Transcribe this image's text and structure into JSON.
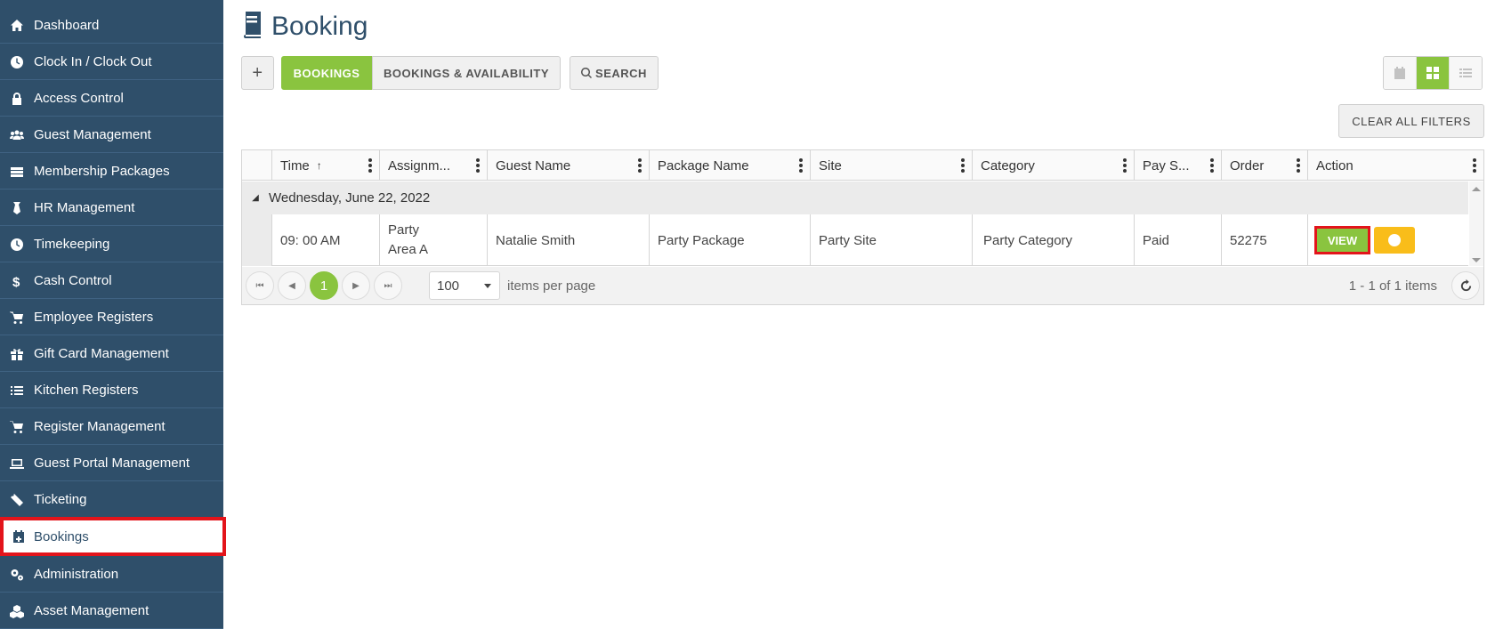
{
  "sidebar": {
    "items": [
      {
        "label": "Dashboard",
        "icon": "home-icon"
      },
      {
        "label": "Clock In / Clock Out",
        "icon": "clock-icon"
      },
      {
        "label": "Access Control",
        "icon": "lock-icon"
      },
      {
        "label": "Guest Management",
        "icon": "users-icon"
      },
      {
        "label": "Membership Packages",
        "icon": "id-card-icon"
      },
      {
        "label": "HR Management",
        "icon": "necktie-icon"
      },
      {
        "label": "Timekeeping",
        "icon": "clock-icon"
      },
      {
        "label": "Cash Control",
        "icon": "dollar-icon"
      },
      {
        "label": "Employee Registers",
        "icon": "cart-icon"
      },
      {
        "label": "Gift Card Management",
        "icon": "gift-icon"
      },
      {
        "label": "Kitchen Registers",
        "icon": "list-check-icon"
      },
      {
        "label": "Register Management",
        "icon": "cart-icon"
      },
      {
        "label": "Guest Portal Management",
        "icon": "laptop-icon"
      },
      {
        "label": "Ticketing",
        "icon": "ticket-icon"
      },
      {
        "label": "Bookings",
        "icon": "calendar-plus-icon",
        "active": true
      },
      {
        "label": "Administration",
        "icon": "cogs-icon"
      },
      {
        "label": "Asset Management",
        "icon": "cubes-icon"
      }
    ]
  },
  "header": {
    "title": "Booking"
  },
  "toolbar": {
    "add_label": "+",
    "bookings_label": "BOOKINGS",
    "availability_label": "BOOKINGS & AVAILABILITY",
    "search_label": "SEARCH",
    "clear_filters_label": "CLEAR ALL FILTERS",
    "views": [
      "calendar-view-icon",
      "grid-view-icon",
      "list-view-icon"
    ],
    "active_view": "grid-view-icon"
  },
  "grid": {
    "columns": [
      "Time",
      "Assignm...",
      "Guest Name",
      "Package Name",
      "Site",
      "Category",
      "Pay S...",
      "Order",
      "Action"
    ],
    "sort_indicator": "↑",
    "group_label": "Wednesday, June 22, 2022",
    "rows": [
      {
        "time": "09: 00 AM",
        "assignment_line1": "Party",
        "assignment_line2": "Area A",
        "guest_name": "Natalie Smith",
        "package_name": "Party Package",
        "site": "Party Site",
        "category": "Party Category",
        "pay_status": "Paid",
        "order": "52275",
        "view_label": "VIEW"
      }
    ],
    "pager": {
      "current_page": "1",
      "per_page": "100",
      "per_page_label": "items per page",
      "info": "1 - 1 of 1 items"
    }
  },
  "colors": {
    "sidebar_bg": "#2f4f6a",
    "accent_green": "#8ac43f",
    "highlight_red": "#e3141b",
    "toggle_yellow": "#f9bd1a"
  }
}
